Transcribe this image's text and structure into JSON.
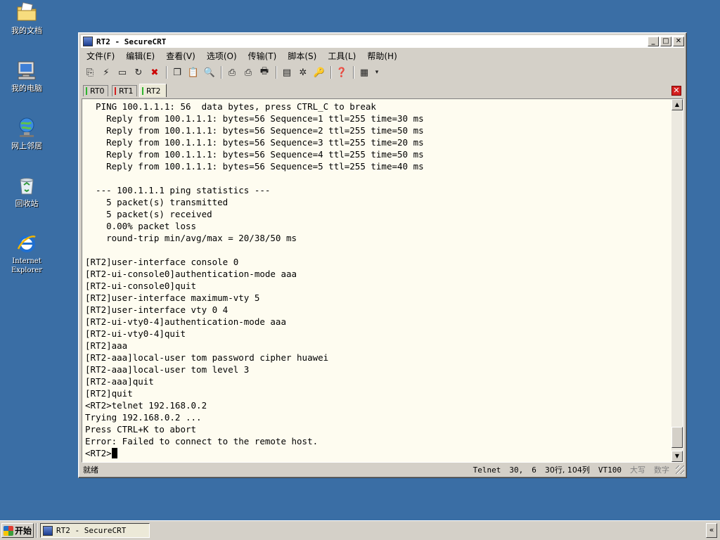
{
  "desktop": {
    "icons": [
      {
        "label": "我的文档",
        "icon": "my-documents-icon"
      },
      {
        "label": "我的电脑",
        "icon": "my-computer-icon"
      },
      {
        "label": "网上邻居",
        "icon": "network-places-icon"
      },
      {
        "label": "回收站",
        "icon": "recycle-bin-icon"
      },
      {
        "label": "Internet\nExplorer",
        "icon": "internet-explorer-icon"
      }
    ]
  },
  "window": {
    "title": "RT2 - SecureCRT",
    "controls": {
      "minimize": "_",
      "maximize": "□",
      "close": "✕"
    }
  },
  "menu": [
    "文件(F)",
    "编辑(E)",
    "查看(V)",
    "选项(O)",
    "传输(T)",
    "脚本(S)",
    "工具(L)",
    "帮助(H)"
  ],
  "tabs": [
    {
      "label": "RT0",
      "color": "#2db52d",
      "active": false
    },
    {
      "label": "RT1",
      "color": "#d22020",
      "active": false
    },
    {
      "label": "RT2",
      "color": "#2db52d",
      "active": true
    }
  ],
  "tab_close": "✕",
  "terminal": {
    "lines": [
      "  PING 100.1.1.1: 56  data bytes, press CTRL_C to break",
      "    Reply from 100.1.1.1: bytes=56 Sequence=1 ttl=255 time=30 ms",
      "    Reply from 100.1.1.1: bytes=56 Sequence=2 ttl=255 time=50 ms",
      "    Reply from 100.1.1.1: bytes=56 Sequence=3 ttl=255 time=20 ms",
      "    Reply from 100.1.1.1: bytes=56 Sequence=4 ttl=255 time=50 ms",
      "    Reply from 100.1.1.1: bytes=56 Sequence=5 ttl=255 time=40 ms",
      "",
      "  --- 100.1.1.1 ping statistics ---",
      "    5 packet(s) transmitted",
      "    5 packet(s) received",
      "    0.00% packet loss",
      "    round-trip min/avg/max = 20/38/50 ms",
      "",
      "[RT2]user-interface console 0",
      "[RT2-ui-console0]authentication-mode aaa",
      "[RT2-ui-console0]quit",
      "[RT2]user-interface maximum-vty 5",
      "[RT2]user-interface vty 0 4",
      "[RT2-ui-vty0-4]authentication-mode aaa",
      "[RT2-ui-vty0-4]quit",
      "[RT2]aaa",
      "[RT2-aaa]local-user tom password cipher huawei",
      "[RT2-aaa]local-user tom level 3",
      "[RT2-aaa]quit",
      "[RT2]quit",
      "<RT2>telnet 192.168.0.2",
      "Trying 192.168.0.2 ...",
      "Press CTRL+K to abort",
      "Error: Failed to connect to the remote host."
    ],
    "prompt": "<RT2>"
  },
  "statusbar": {
    "ready": "就绪",
    "protocol": "Telnet",
    "row": "30,",
    "col": "6",
    "size": "30行, 104列",
    "emulation": "VT100",
    "caps": "大写",
    "num": "数字"
  },
  "taskbar": {
    "start_label": "开始",
    "task_title": "RT2 - SecureCRT",
    "tray_chevron": "«"
  }
}
